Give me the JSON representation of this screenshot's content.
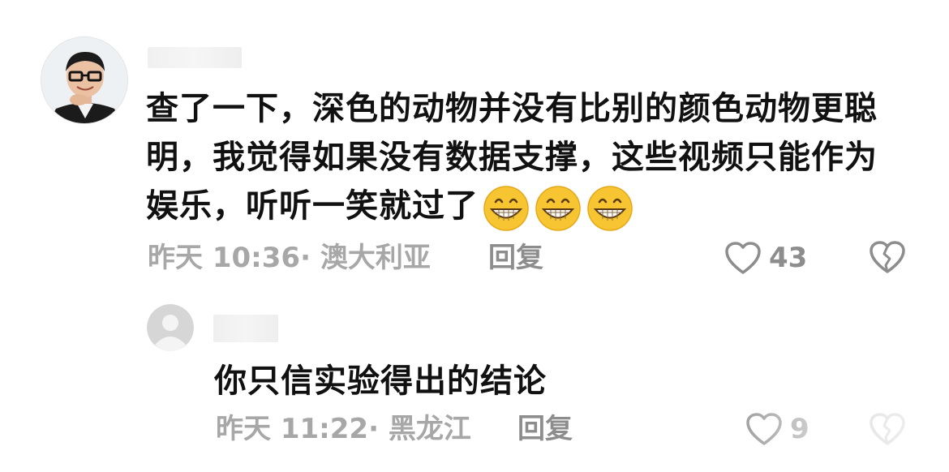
{
  "comment": {
    "text": "查了一下，深色的动物并没有比别的颜色动物更聪明，我觉得如果没有数据支撑，这些视频只能作为娱乐，听听一笑就过了",
    "emojis": [
      "grinning-face-icon",
      "grinning-face-icon",
      "grinning-face-icon"
    ],
    "time": "昨天 10:36",
    "separator": "·",
    "location": "澳大利亚",
    "reply_label": "回复",
    "like_count": "43"
  },
  "reply": {
    "text": "你只信实验得出的结论",
    "time": "昨天 11:22",
    "separator": "·",
    "location": "黑龙江",
    "reply_label": "回复",
    "like_count": "9"
  },
  "colors": {
    "text_primary": "#111111",
    "text_meta": "#a7a7a7",
    "icon_gray": "#8d8d8d",
    "emoji_yellow": "#f7c531"
  }
}
